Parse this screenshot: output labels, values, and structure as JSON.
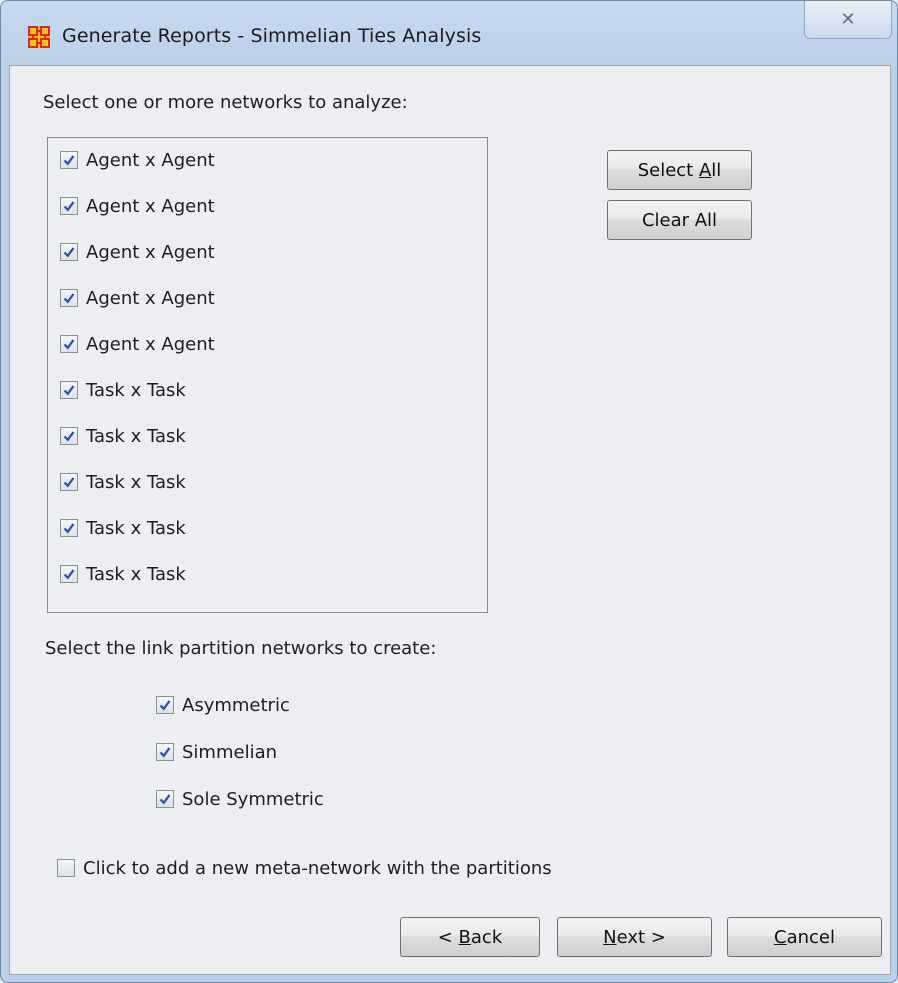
{
  "window": {
    "title": "Generate Reports - Simmelian Ties Analysis",
    "close_glyph": "✕"
  },
  "networks": {
    "label": "Select one or more networks to analyze:",
    "items": [
      {
        "label": "Agent x Agent",
        "checked": true
      },
      {
        "label": "Agent x Agent",
        "checked": true
      },
      {
        "label": "Agent x Agent",
        "checked": true
      },
      {
        "label": "Agent x Agent",
        "checked": true
      },
      {
        "label": "Agent x Agent",
        "checked": true
      },
      {
        "label": "Task x Task",
        "checked": true
      },
      {
        "label": "Task x Task",
        "checked": true
      },
      {
        "label": "Task x Task",
        "checked": true
      },
      {
        "label": "Task x Task",
        "checked": true
      },
      {
        "label": "Task x Task",
        "checked": true
      }
    ],
    "select_all_pre": "Select ",
    "select_all_mnemonic": "A",
    "select_all_post": "ll",
    "clear_all_label": "Clear All"
  },
  "partitions": {
    "label": "Select the link partition networks to create:",
    "items": [
      {
        "label": "Asymmetric",
        "checked": true
      },
      {
        "label": "Simmelian",
        "checked": true
      },
      {
        "label": "Sole Symmetric",
        "checked": true
      }
    ]
  },
  "meta_network": {
    "label": "Click to add a new meta-network with the partitions",
    "checked": false
  },
  "footer": {
    "back_pre": "< ",
    "back_mnemonic": "B",
    "back_post": "ack",
    "next_mnemonic": "N",
    "next_post": "ext >",
    "cancel_mnemonic": "C",
    "cancel_post": "ancel"
  },
  "colors": {
    "check_mark": "#2a4f9c",
    "icon_red": "#d82a1c",
    "icon_yellow": "#f3c21b"
  }
}
